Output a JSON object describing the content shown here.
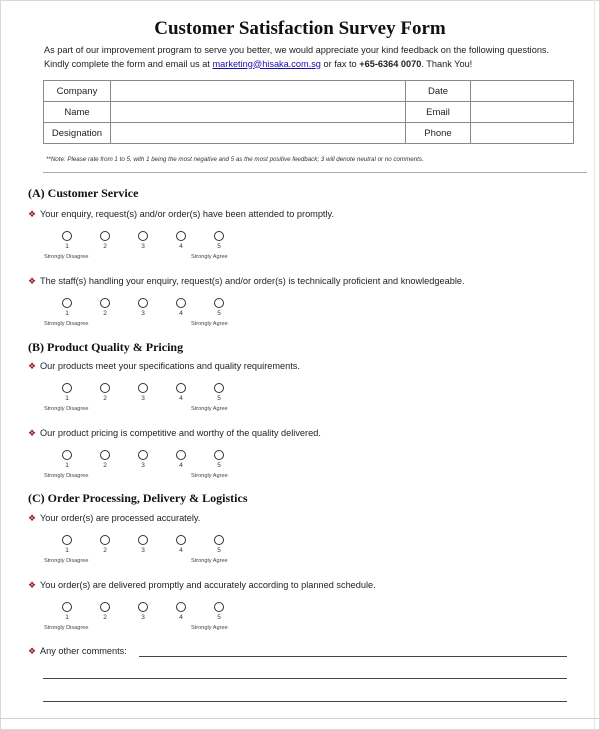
{
  "title": "Customer Satisfaction Survey Form",
  "intro": {
    "text_before_link": "As part of our improvement program to serve you better, we would appreciate your kind feedback on the following questions.  Kindly complete the form and email us at ",
    "email_link": "marketing@hisaka.com.sg",
    "text_mid": " or fax to ",
    "fax": "+65-6364 0070",
    "text_end": ". Thank You!"
  },
  "info_table": {
    "rows": [
      {
        "label": "Company",
        "value": "",
        "label2": "Date",
        "value2": ""
      },
      {
        "label": "Name",
        "value": "",
        "label2": "Email",
        "value2": ""
      },
      {
        "label": "Designation",
        "value": "",
        "label2": "Phone",
        "value2": ""
      }
    ]
  },
  "note": "**Note: Please rate from 1 to 5, with 1 being the most negative and 5 as the most positive feedback; 3 will denote neutral or no comments.",
  "scale": {
    "options": [
      "1",
      "2",
      "3",
      "4",
      "5"
    ],
    "low_anchor": "Strongly Disagree",
    "high_anchor": "Strongly Agree"
  },
  "sections": [
    {
      "heading": "(A) Customer Service",
      "questions": [
        "Your enquiry, request(s) and/or order(s) have been attended to promptly.",
        "The staff(s) handling your enquiry, request(s) and/or order(s) is technically proficient and knowledgeable."
      ]
    },
    {
      "heading": "(B) Product Quality & Pricing",
      "questions": [
        "Our products meet your specifications and quality requirements.",
        "Our product pricing is competitive and worthy of the quality delivered."
      ]
    },
    {
      "heading": "(C) Order Processing, Delivery & Logistics",
      "questions": [
        "Your order(s) are processed accurately.",
        "You order(s) are delivered promptly and accurately according to planned schedule."
      ]
    }
  ],
  "comments": {
    "label": "Any other comments:",
    "value": ""
  },
  "colors": {
    "bullet": "#9b1c1c",
    "link": "#1a0dab"
  }
}
